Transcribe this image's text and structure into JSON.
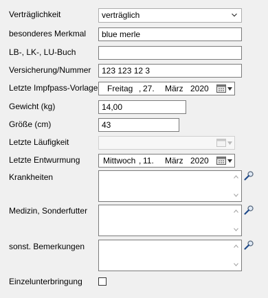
{
  "form": {
    "vertraeglichkeit": {
      "label": "Verträglichkeit",
      "value": "verträglich"
    },
    "merkmal": {
      "label": "besonderes Merkmal",
      "value": "blue merle"
    },
    "buch": {
      "label": "LB-, LK-, LU-Buch",
      "value": ""
    },
    "versicherung": {
      "label": "Versicherung/Nummer",
      "value": "123 123 12 3"
    },
    "impfpass": {
      "label": "Letzte Impfpass-Vorlage",
      "weekday": "Freitag",
      "sep": ",",
      "day": "27.",
      "month": "März",
      "year": "2020"
    },
    "gewicht": {
      "label": "Gewicht (kg)",
      "value": "14,00"
    },
    "groesse": {
      "label": "Größe (cm)",
      "value": "43"
    },
    "laeufigkeit": {
      "label": "Letzte Läufigkeit"
    },
    "entwurmung": {
      "label": "Letzte Entwurmung",
      "weekday": "Mittwoch",
      "sep": ",",
      "day": "11.",
      "month": "März",
      "year": "2020"
    },
    "krankheiten": {
      "label": "Krankheiten",
      "value": ""
    },
    "medizin": {
      "label": "Medizin, Sonderfutter",
      "value": ""
    },
    "bemerkungen": {
      "label": "sonst. Bemerkungen",
      "value": ""
    },
    "einzel": {
      "label": "Einzelunterbringung",
      "checked": false
    }
  }
}
